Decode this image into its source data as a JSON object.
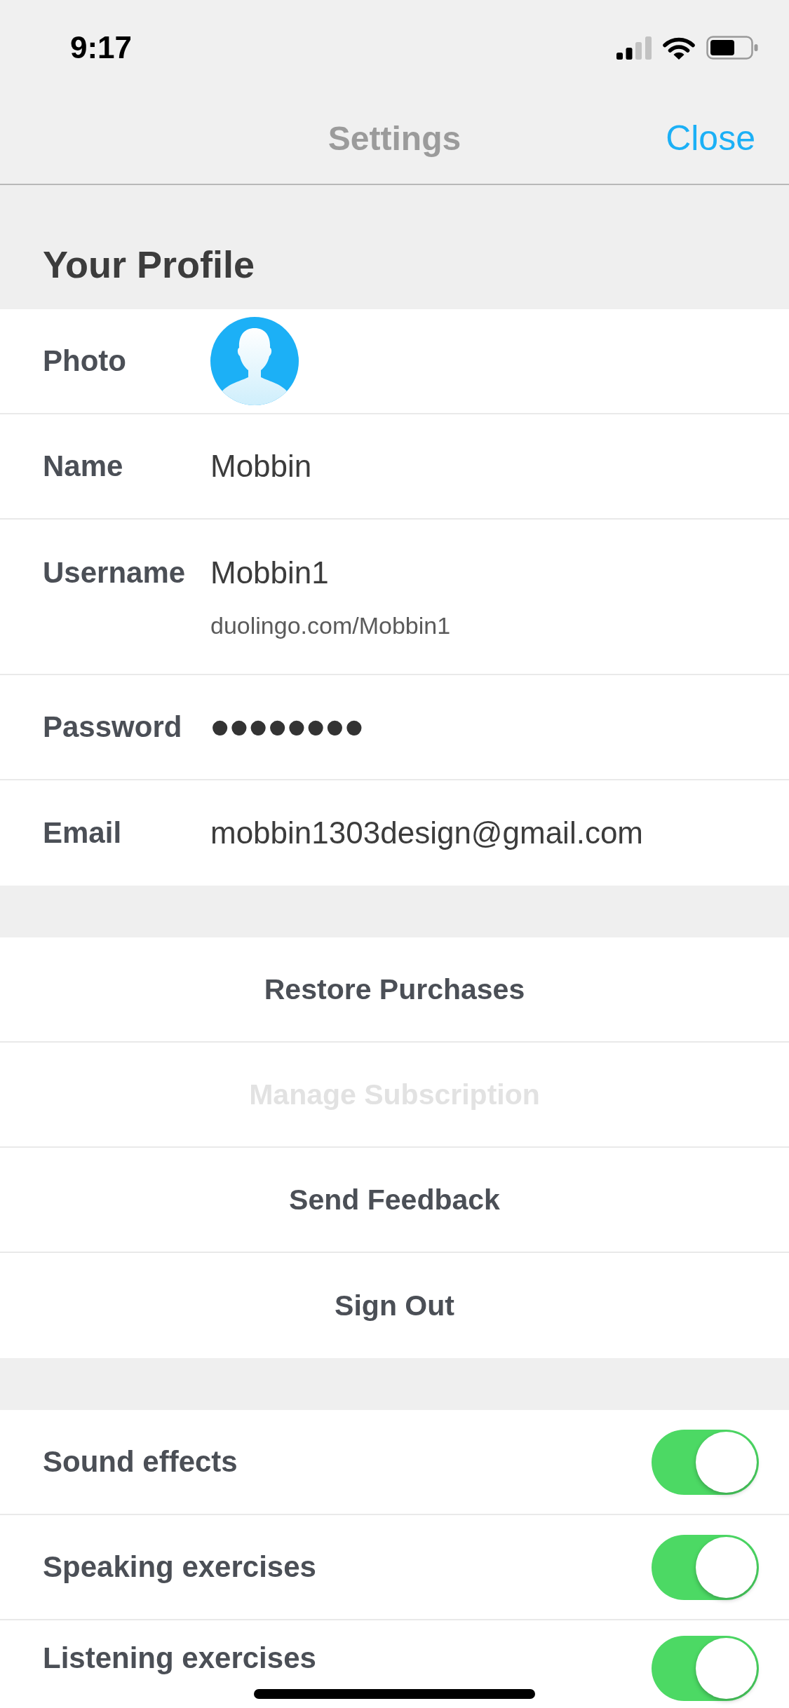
{
  "status_bar": {
    "time": "9:17"
  },
  "nav": {
    "title": "Settings",
    "close": "Close"
  },
  "profile": {
    "heading": "Your Profile",
    "rows": [
      {
        "kind": "photo",
        "label": "Photo"
      },
      {
        "kind": "text",
        "label": "Name",
        "value": "Mobbin"
      },
      {
        "kind": "text",
        "label": "Username",
        "value": "Mobbin1",
        "detail": "duolingo.com/Mobbin1"
      },
      {
        "kind": "password",
        "label": "Password",
        "value": "••••••••"
      },
      {
        "kind": "text",
        "label": "Email",
        "value": "mobbin1303design@gmail.com"
      }
    ]
  },
  "actions": [
    {
      "label": "Restore Purchases",
      "disabled": false
    },
    {
      "label": "Manage Subscription",
      "disabled": true
    },
    {
      "label": "Send Feedback",
      "disabled": false
    },
    {
      "label": "Sign Out",
      "disabled": false
    }
  ],
  "toggles": [
    {
      "label": "Sound effects",
      "on": true
    },
    {
      "label": "Speaking exercises",
      "on": true
    },
    {
      "label": "Listening exercises",
      "on": true
    }
  ]
}
